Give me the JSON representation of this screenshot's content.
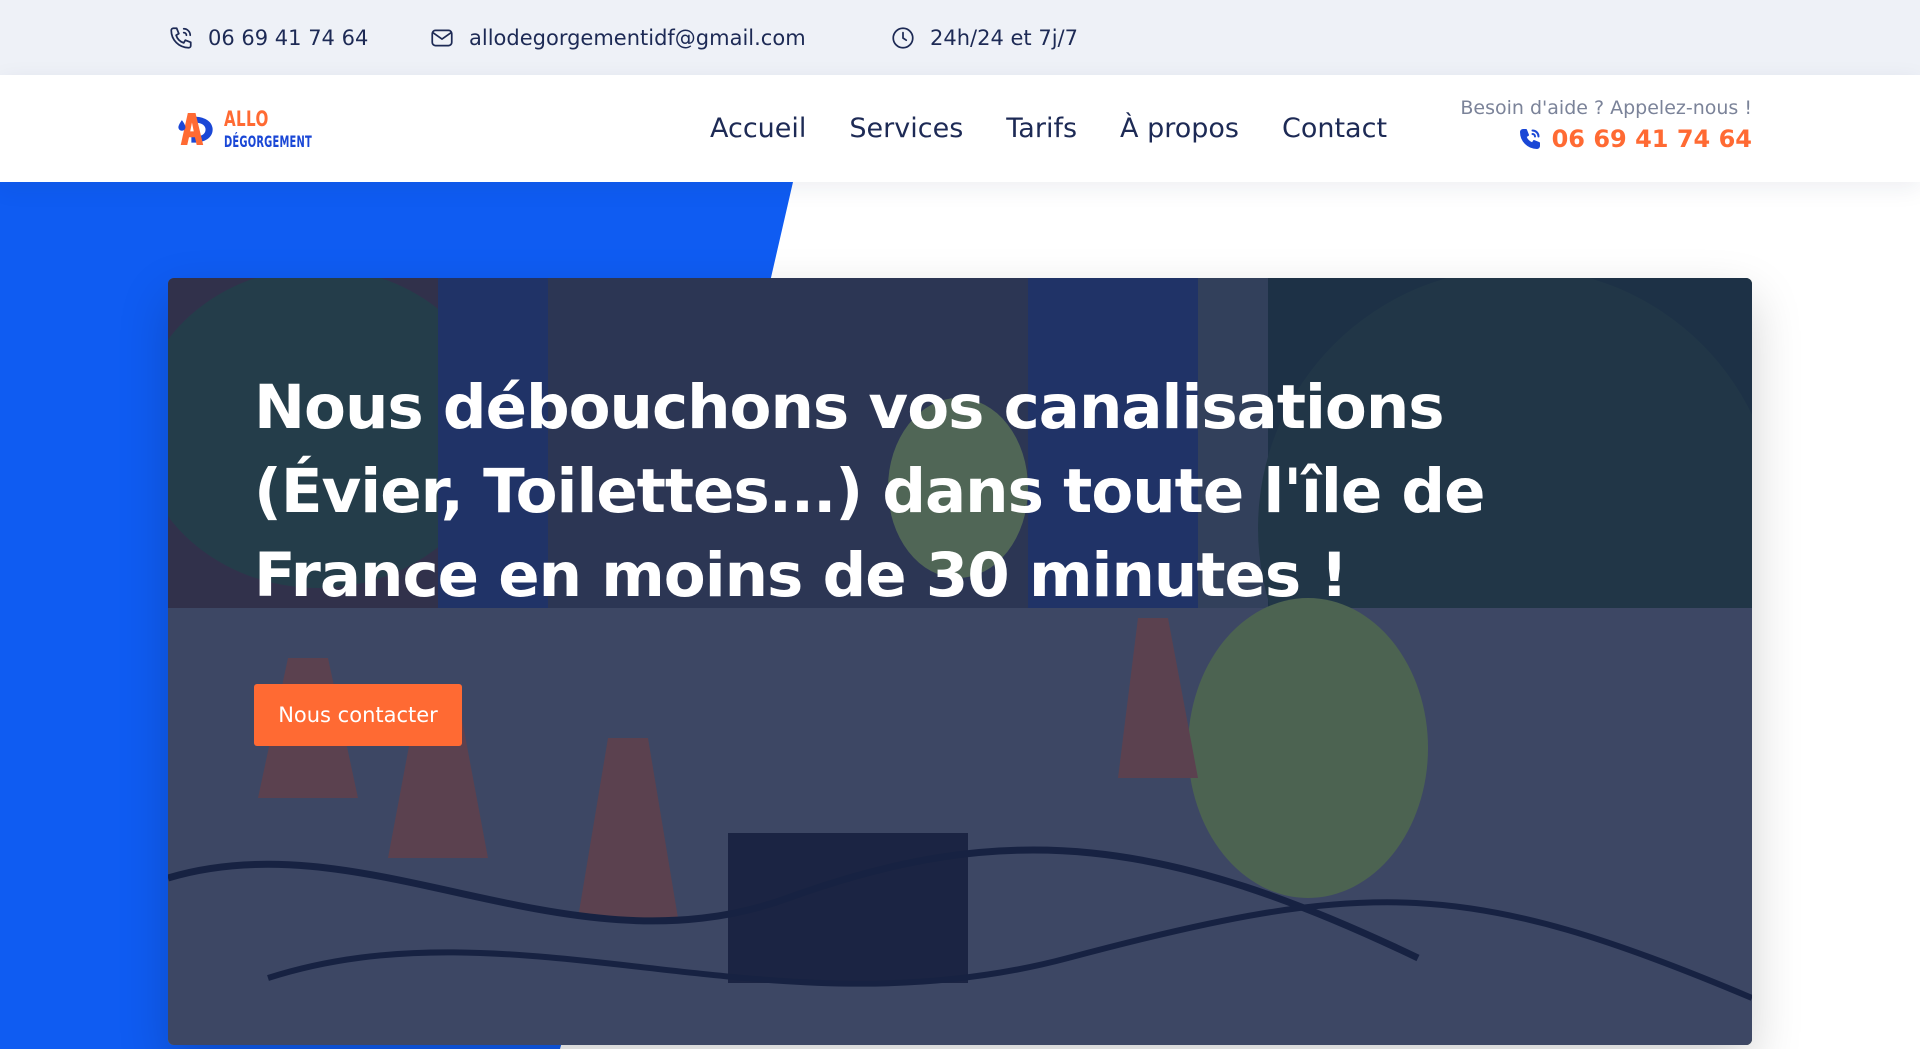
{
  "topbar": {
    "phone": "06 69 41 74 64",
    "email": "allodegorgementidf@gmail.com",
    "hours": "24h/24 et 7j/7"
  },
  "logo": {
    "line1": "ALLO",
    "line2": "DÉGORGEMENT"
  },
  "nav": {
    "items": [
      "Accueil",
      "Services",
      "Tarifs",
      "À propos",
      "Contact"
    ]
  },
  "help": {
    "label": "Besoin d'aide ? Appelez-nous !",
    "phone": "06 69 41 74 64"
  },
  "hero": {
    "title": "Nous débouchons vos canalisations (Évier, Toilettes...) dans toute l'île de France en moins de 30 minutes !",
    "button": "Nous contacter"
  },
  "colors": {
    "accent_orange": "#ff6a33",
    "brand_blue": "#0f5cf2",
    "navy_text": "#1d2a55",
    "topbar_bg": "#eef1f7"
  },
  "icons": {
    "phone": "phone-icon",
    "email": "mail-icon",
    "hours": "clock-icon"
  }
}
